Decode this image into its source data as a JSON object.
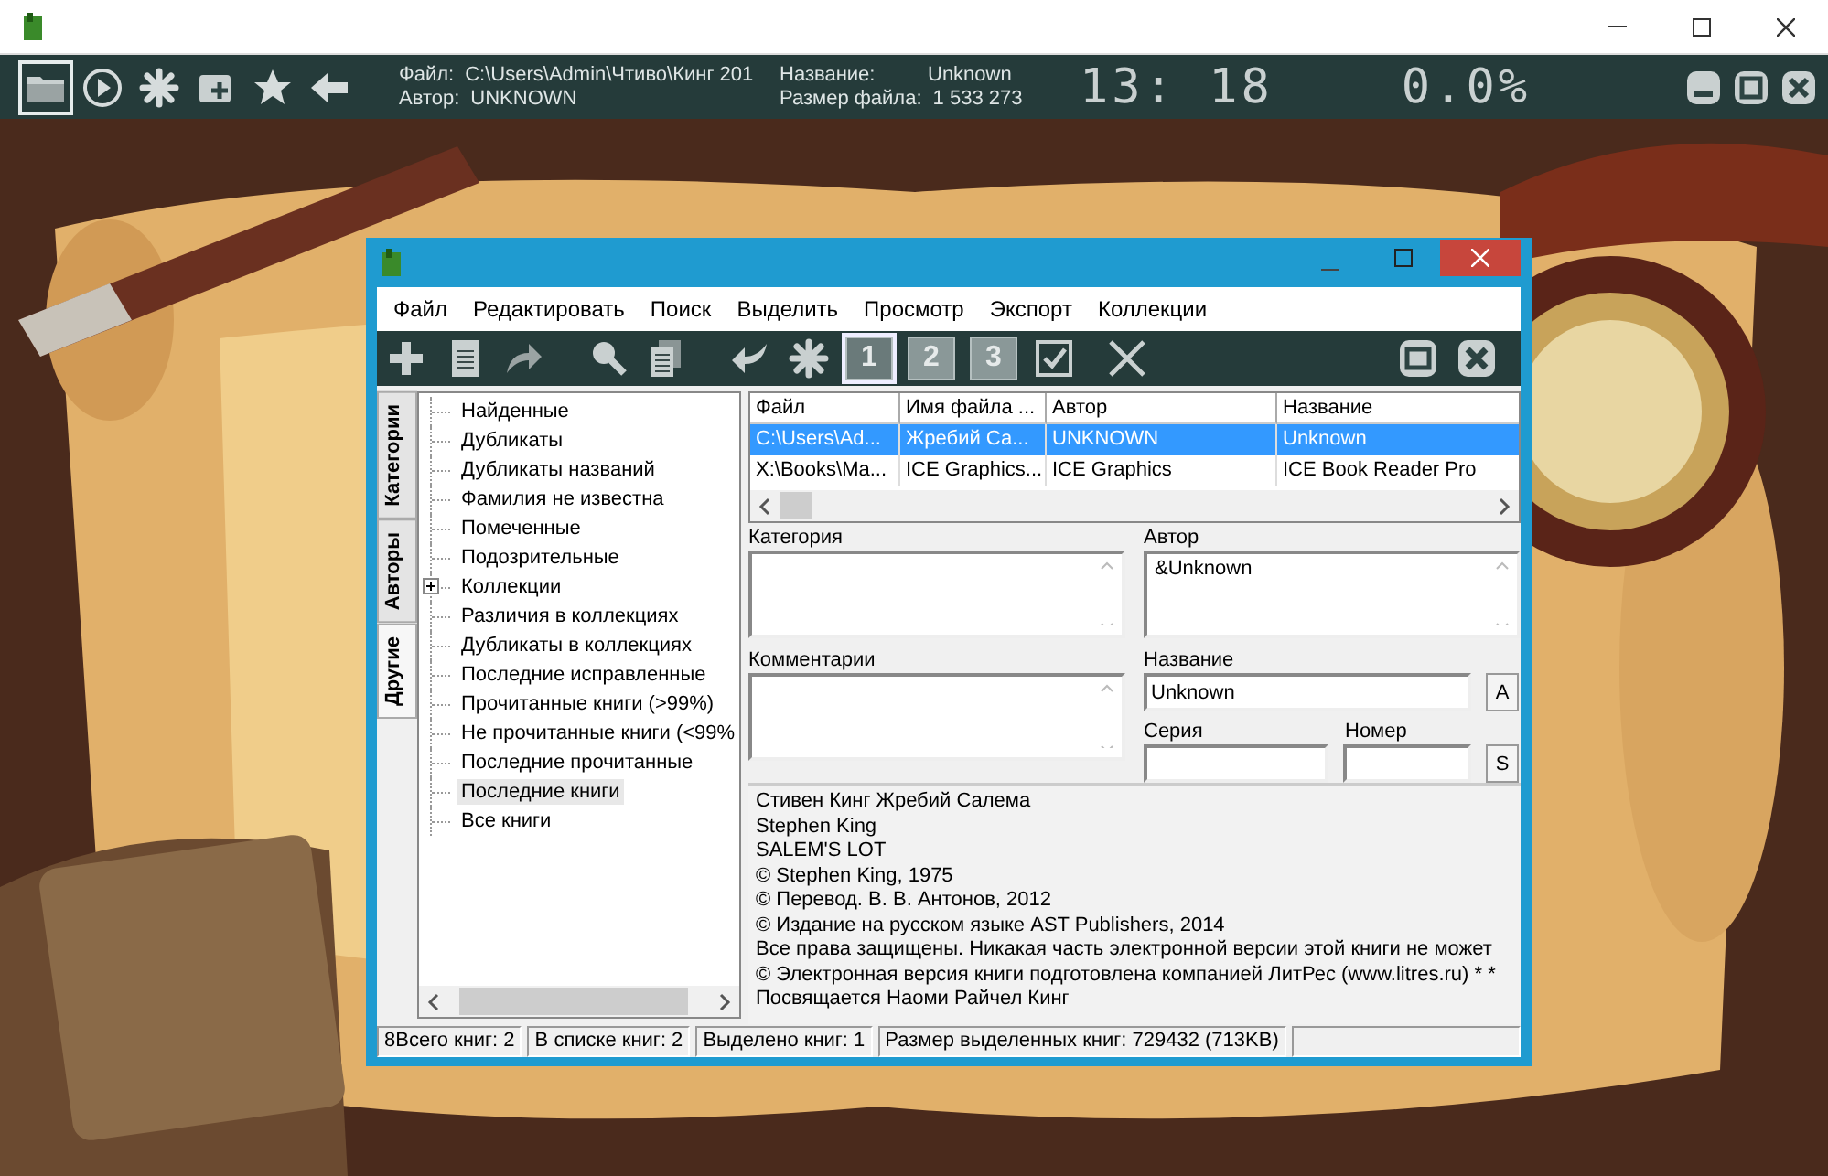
{
  "player": {
    "tool_buttons": [
      {
        "selected": true
      },
      {
        "selected": false
      },
      {
        "selected": false
      },
      {
        "selected": false
      },
      {
        "selected": false
      },
      {
        "selected": false
      }
    ],
    "file_label": "Файл:",
    "file_value": "C:\\Users\\Admin\\Чтиво\\Кинг 201",
    "author_label": "Автор:",
    "author_value": "UNKNOWN",
    "title_label": "Название:",
    "title_value": "Unknown",
    "size_label": "Размер файла:",
    "size_value": "1 533 273",
    "clock": "13: 18",
    "progress": "0.0%"
  },
  "library": {
    "menu": [
      "Файл",
      "Редактировать",
      "Поиск",
      "Выделить",
      "Просмотр",
      "Экспорт",
      "Коллекции"
    ],
    "view_buttons": [
      {
        "label": "1",
        "selected": true
      },
      {
        "label": "2",
        "selected": false
      },
      {
        "label": "3",
        "selected": false
      }
    ],
    "side_tabs": [
      {
        "label": "Категории",
        "selected": false
      },
      {
        "label": "Авторы",
        "selected": false
      },
      {
        "label": "Другие",
        "selected": true
      }
    ],
    "tree": [
      {
        "label": "Найденные",
        "kind": "leaf",
        "selected": false
      },
      {
        "label": "Дубликаты",
        "kind": "leaf",
        "selected": false
      },
      {
        "label": "Дубликаты названий",
        "kind": "leaf",
        "selected": false
      },
      {
        "label": "Фамилия не известна",
        "kind": "leaf",
        "selected": false
      },
      {
        "label": "Помеченные",
        "kind": "leaf",
        "selected": false
      },
      {
        "label": "Подозрительные",
        "kind": "leaf",
        "selected": false
      },
      {
        "label": "Коллекции",
        "kind": "folder",
        "expanded": false,
        "selected": false
      },
      {
        "label": "Различия в коллекциях",
        "kind": "leaf",
        "selected": false
      },
      {
        "label": "Дубликаты в коллекциях",
        "kind": "leaf",
        "selected": false
      },
      {
        "label": "Последние исправленные",
        "kind": "leaf",
        "selected": false
      },
      {
        "label": "Прочитанные книги (>99%)",
        "kind": "leaf",
        "selected": false
      },
      {
        "label": "Не прочитанные книги (<99%",
        "kind": "leaf",
        "selected": false
      },
      {
        "label": "Последние прочитанные",
        "kind": "leaf",
        "selected": false
      },
      {
        "label": "Последние книги",
        "kind": "leaf",
        "selected": true
      },
      {
        "label": "Все книги",
        "kind": "leaf",
        "selected": false
      }
    ],
    "table": {
      "columns": [
        "Файл",
        "Имя файла ...",
        "Автор",
        "Название"
      ],
      "rows": [
        {
          "cells": [
            "C:\\Users\\Ad...",
            "Жребий Са...",
            "UNKNOWN",
            "Unknown"
          ],
          "selected": true
        },
        {
          "cells": [
            "X:\\Books\\Ma...",
            "ICE Graphics...",
            "ICE Graphics",
            "ICE Book Reader Pro"
          ],
          "selected": false
        }
      ]
    },
    "fields": {
      "category_label": "Категория",
      "author_label": "Автор",
      "author_value": "&Unknown",
      "comments_label": "Комментарии",
      "title_label": "Название",
      "title_value": "Unknown",
      "title_button": "A",
      "series_label": "Серия",
      "number_label": "Номер",
      "series_button": "S"
    },
    "description": [
      "Стивен Кинг Жребий Салема",
      "Stephen King",
      "SALEM'S LOT",
      "© Stephen King, 1975",
      "© Перевод. В. В. Антонов, 2012",
      "© Издание на русском языке AST Publishers, 2014",
      "Все права защищены. Никакая часть электронной версии этой книги не может",
      "© Электронная версия книги подготовлена компанией ЛитРес (www.litres.ru) * *",
      "Посвящается Наоми Райчел Кинг"
    ],
    "status_bar": [
      "8Всего книг: 2",
      "В списке книг: 2",
      "Выделено книг: 1",
      "Размер выделенных книг: 729432  (713KB)"
    ]
  }
}
